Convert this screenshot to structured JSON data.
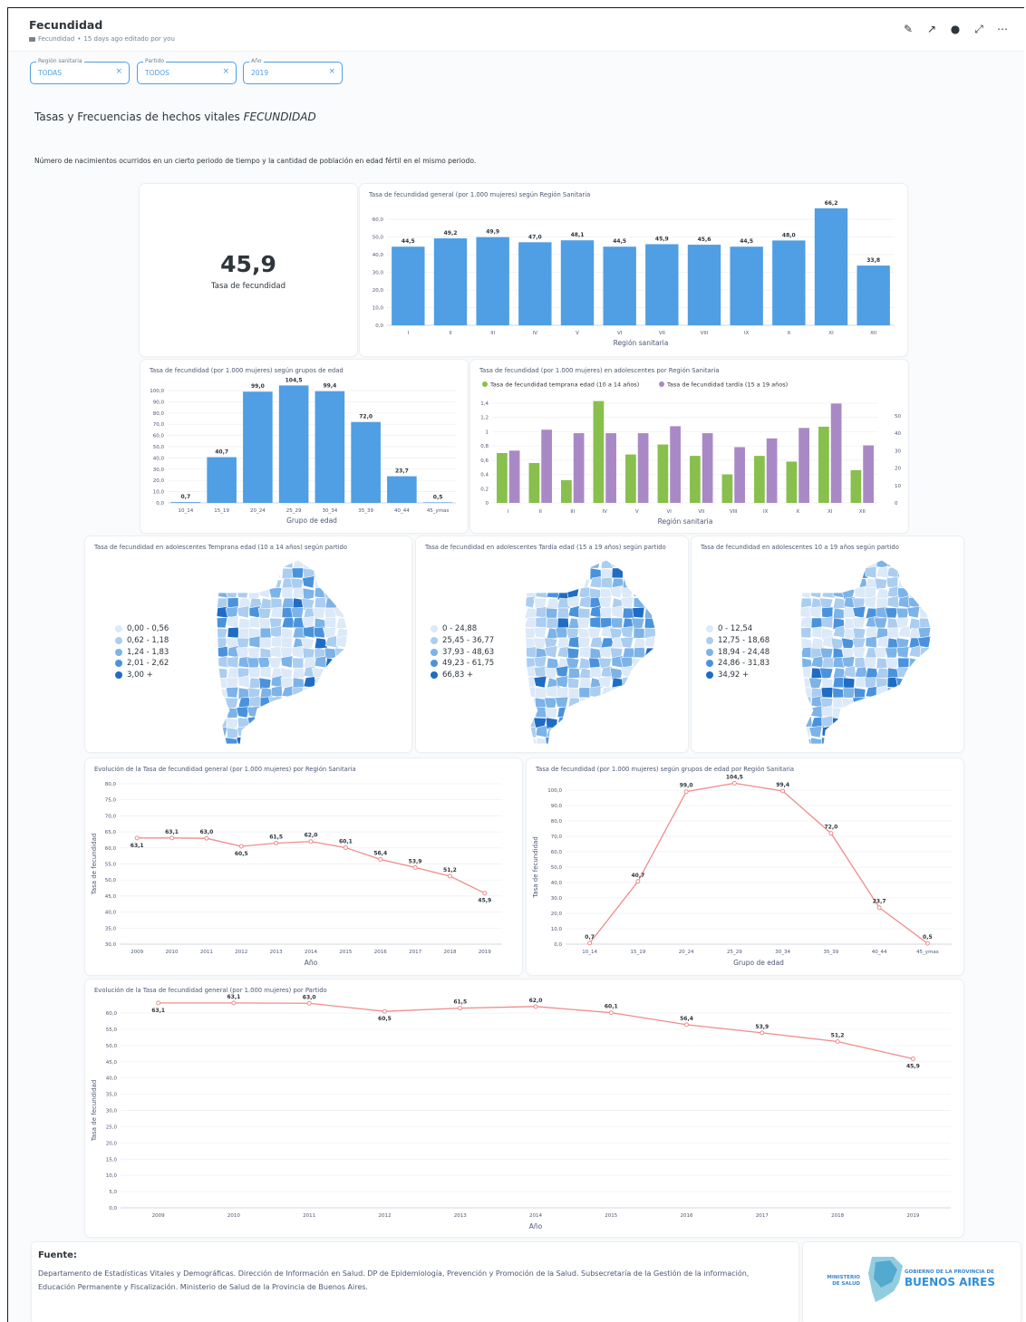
{
  "header": {
    "title": "Fecundidad",
    "collection": "Fecundidad",
    "edited": "15 days ago editado por you",
    "tools": [
      "pencil-icon",
      "share-arrow-icon",
      "clock-icon",
      "expand-icon",
      "more-icon"
    ]
  },
  "filters": [
    {
      "label": "Región sanitaria",
      "value": "TODAS"
    },
    {
      "label": "Partido",
      "value": "TODOS"
    },
    {
      "label": "Año",
      "value": "2019"
    }
  ],
  "heading": {
    "prefix": "Tasas y Frecuencias de hechos vitales ",
    "emph": "FECUNDIDAD"
  },
  "description": "Número de nacimientos ocurridos en un cierto periodo de tiempo y la cantidad de población en edad fértil en el mismo periodo.",
  "scalar": {
    "value": "45,9",
    "label": "Tasa de fecundidad"
  },
  "maps": [
    {
      "title": "Tasa de fecundidad en adolescentes Temprana edad (10 a 14 años) según partido",
      "legend": [
        "0,00 - 0,56",
        "0,62 - 1,18",
        "1,24 - 1,83",
        "2,01 - 2,62",
        "3,00 +"
      ]
    },
    {
      "title": "Tasa de fecundidad en adolescentes Tardía edad (15 a 19 años) según partido",
      "legend": [
        "0 - 24,88",
        "25,45 - 36,77",
        "37,93 - 48,63",
        "49,23 - 61,75",
        "66,83 +"
      ]
    },
    {
      "title": "Tasa de fecundidad en adolescentes 10 a 19 años según partido",
      "legend": [
        "0 - 12,54",
        "12,75 - 18,68",
        "18,94 - 24,48",
        "24,86 - 31,83",
        "34,92 +"
      ]
    }
  ],
  "colors": {
    "bar": "#509ee3",
    "green": "#88bf4d",
    "purple": "#a989c5",
    "line": "#ef8c8c",
    "map_scale": [
      "#dbe9f8",
      "#aacdf0",
      "#7cb3e8",
      "#4a93dc",
      "#1f6cc4"
    ]
  },
  "fuente": {
    "title": "Fuente:",
    "text": "Departamento de Estadísticas Vitales y Demográficas. Dirección de Información en Salud. DP de Epidemiología, Prevención y Promoción de la Salud. Subsecretaría de la Gestión de la información, Educación Permanente y Fiscalización. Ministerio de Salud de la Provincia de Buenos Aires."
  },
  "logo": {
    "ministerio": "MINISTERIO DE SALUD",
    "gobierno": "GOBIERNO DE LA PROVINCIA DE",
    "provincia": "BUENOS AIRES"
  },
  "chart_data": [
    {
      "type": "bar",
      "title": "Tasa de fecundidad general (por 1.000 mujeres) según Región Sanitaria",
      "xlabel": "Región sanitaria",
      "ylabel": "",
      "categories": [
        "I",
        "II",
        "III",
        "IV",
        "V",
        "VI",
        "VII",
        "VIII",
        "IX",
        "X",
        "XI",
        "XII"
      ],
      "values": [
        44.5,
        49.2,
        49.9,
        47.0,
        48.1,
        44.5,
        45.9,
        45.6,
        44.5,
        48.0,
        66.2,
        33.8
      ],
      "labels": [
        "44,5",
        "49,2",
        "49,9",
        "47,0",
        "48,1",
        "44,5",
        "45,9",
        "45,6",
        "44,5",
        "48,0",
        "66,2",
        "33,8"
      ],
      "ylim": [
        0,
        60
      ],
      "yticks": [
        "0,0",
        "10,0",
        "20,0",
        "30,0",
        "40,0",
        "50,0",
        "60,0"
      ]
    },
    {
      "type": "bar",
      "title": "Tasa de fecundidad (por 1.000 mujeres) según grupos de edad",
      "xlabel": "Grupo de edad",
      "ylabel": "",
      "categories": [
        "10_14",
        "15_19",
        "20_24",
        "25_29",
        "30_34",
        "35_39",
        "40_44",
        "45_ymas"
      ],
      "values": [
        0.7,
        40.7,
        99.0,
        104.5,
        99.4,
        72.0,
        23.7,
        0.5
      ],
      "labels": [
        "0,7",
        "40,7",
        "99,0",
        "104,5",
        "99,4",
        "72,0",
        "23,7",
        "0,5"
      ],
      "ylim": [
        0,
        100
      ],
      "yticks": [
        "0,0",
        "10,0",
        "20,0",
        "30,0",
        "40,0",
        "50,0",
        "60,0",
        "70,0",
        "80,0",
        "90,0",
        "100,0"
      ]
    },
    {
      "type": "bar",
      "title": "Tasa de fecundidad (por 1.000 mujeres) en adolescentes por Región Sanitaria",
      "xlabel": "Región sanitaria",
      "ylabel": "",
      "categories": [
        "I",
        "II",
        "III",
        "IV",
        "V",
        "VI",
        "VII",
        "VIII",
        "IX",
        "X",
        "XI",
        "XII"
      ],
      "series": [
        {
          "name": "Tasa de fecundidad temprana edad (10 a 14 años)",
          "axis": "left",
          "values": [
            0.7,
            0.56,
            0.32,
            1.43,
            0.68,
            0.82,
            0.66,
            0.4,
            0.66,
            0.58,
            1.07,
            0.46
          ]
        },
        {
          "name": "Tasa de fecundidad tardía (15 a 19 años)",
          "axis": "right",
          "values": [
            30,
            42,
            40,
            40,
            40,
            44,
            40,
            32,
            37,
            43,
            57,
            33
          ]
        }
      ],
      "ylim_left": [
        0,
        1.4
      ],
      "yticks_left": [
        "0",
        "0,2",
        "0,4",
        "0,6",
        "0,8",
        "1",
        "1,2",
        "1,4"
      ],
      "ylim_right": [
        0,
        50
      ],
      "yticks_right": [
        "0",
        "10",
        "20",
        "30",
        "40",
        "50"
      ]
    },
    {
      "type": "line",
      "title": "Evolución de la Tasa de fecundidad general (por 1.000 mujeres) por Región Sanitaria",
      "xlabel": "Año",
      "ylabel": "Tasa de fecundidad",
      "x": [
        "2009",
        "2010",
        "2011",
        "2012",
        "2013",
        "2014",
        "2015",
        "2016",
        "2017",
        "2018",
        "2019"
      ],
      "values": [
        63.1,
        63.1,
        63.0,
        60.5,
        61.5,
        62.0,
        60.1,
        56.4,
        53.9,
        51.2,
        45.9
      ],
      "labels": [
        "63,1",
        "63,1",
        "63,0",
        "60,5",
        "61,5",
        "62,0",
        "60,1",
        "56,4",
        "53,9",
        "51,2",
        "45,9"
      ],
      "ylim": [
        30,
        80
      ],
      "yticks": [
        "30,0",
        "35,0",
        "40,0",
        "45,0",
        "50,0",
        "55,0",
        "60,0",
        "65,0",
        "70,0",
        "75,0",
        "80,0"
      ]
    },
    {
      "type": "line",
      "title": "Tasa de fecundidad (por 1.000 mujeres) según grupos de edad por Región Sanitaria",
      "xlabel": "Grupo de edad",
      "ylabel": "Tasa de fecundidad",
      "x": [
        "10_14",
        "15_19",
        "20_24",
        "25_29",
        "30_34",
        "35_39",
        "40_44",
        "45_ymas"
      ],
      "values": [
        0.7,
        40.7,
        99.0,
        104.5,
        99.4,
        72.0,
        23.7,
        0.5
      ],
      "labels": [
        "0,7",
        "40,7",
        "99,0",
        "104,5",
        "99,4",
        "72,0",
        "23,7",
        "0,5"
      ],
      "ylim": [
        0,
        100
      ],
      "yticks": [
        "0,0",
        "10,0",
        "20,0",
        "30,0",
        "40,0",
        "50,0",
        "60,0",
        "70,0",
        "80,0",
        "90,0",
        "100,0"
      ]
    },
    {
      "type": "line",
      "title": "Evolución de la Tasa de fecundidad general (por 1.000 mujeres) por Partido",
      "xlabel": "Año",
      "ylabel": "Tasa de fecundidad",
      "x": [
        "2009",
        "2010",
        "2011",
        "2012",
        "2013",
        "2014",
        "2015",
        "2016",
        "2017",
        "2018",
        "2019"
      ],
      "values": [
        63.1,
        63.1,
        63.0,
        60.5,
        61.5,
        62.0,
        60.1,
        56.4,
        53.9,
        51.2,
        45.9
      ],
      "labels": [
        "63,1",
        "63,1",
        "63,0",
        "60,5",
        "61,5",
        "62,0",
        "60,1",
        "56,4",
        "53,9",
        "51,2",
        "45,9"
      ],
      "ylim": [
        0,
        60
      ],
      "yticks": [
        "0,0",
        "5,0",
        "10,0",
        "15,0",
        "20,0",
        "25,0",
        "30,0",
        "35,0",
        "40,0",
        "45,0",
        "50,0",
        "55,0",
        "60,0"
      ]
    }
  ]
}
